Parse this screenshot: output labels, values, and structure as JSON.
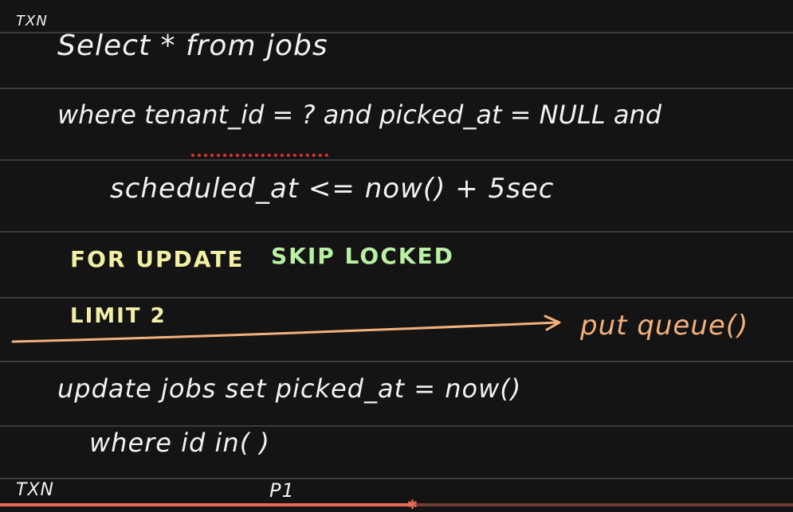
{
  "board": {
    "txn_label_top": "TXN",
    "line_select": "Select * from jobs",
    "line_where": "where tenant_id = ? and picked_at = NULL and",
    "line_scheduled": "scheduled_at <= now() + 5sec",
    "for_update": "FOR UPDATE",
    "skip_locked": "SKIP LOCKED",
    "limit": "LIMIT 2",
    "arrow_target": "put queue()",
    "update_line": "update jobs set picked_at = now()",
    "where_in_line": "where id in( )",
    "txn_label_bottom": "TXN",
    "p1_label": "P1"
  },
  "player": {
    "progress_fraction": 0.52
  },
  "colors": {
    "background": "#141414",
    "ink_white": "#f2f2f2",
    "ink_yellow": "#f3f0a6",
    "ink_green": "#b9f0a3",
    "ink_orange": "#f3b07c",
    "underline_red": "#e0322b",
    "progress_red": "#ea6a5a"
  }
}
